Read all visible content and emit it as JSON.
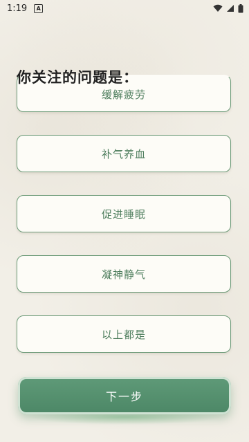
{
  "status_bar": {
    "time": "1:19",
    "notification_badge": "A"
  },
  "question": {
    "title": "你关注的问题是："
  },
  "options": [
    {
      "label": "缓解疲劳"
    },
    {
      "label": "补气养血"
    },
    {
      "label": "促进睡眠"
    },
    {
      "label": "凝神静气"
    },
    {
      "label": "以上都是"
    }
  ],
  "next_button": {
    "label": "下一步"
  },
  "colors": {
    "accent": "#4c8766",
    "border": "#6b9a77",
    "text": "#4d7d5c",
    "background": "#f2efe7"
  }
}
